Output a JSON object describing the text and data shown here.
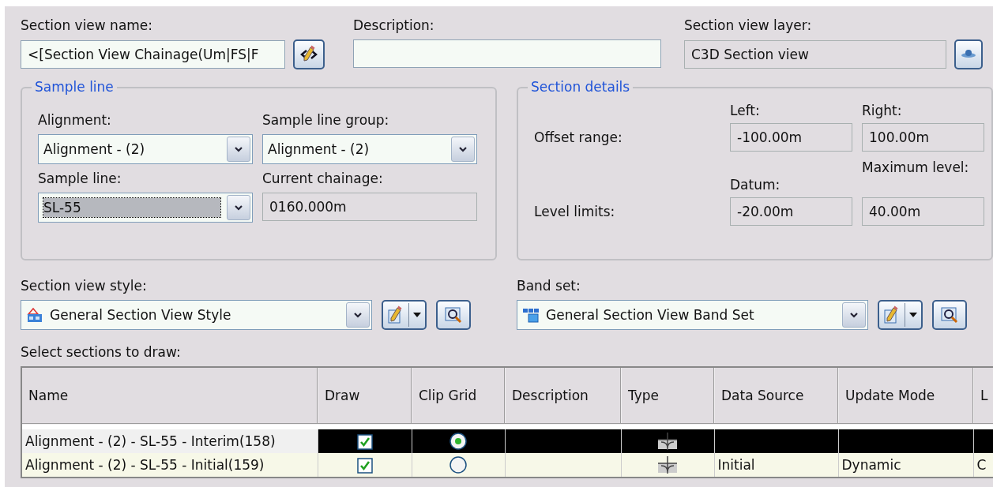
{
  "name_field": {
    "label": "Section view name:",
    "value": "<[Section View Chainage(Um|FS|F",
    "disabled": false
  },
  "description_field": {
    "label": "Description:",
    "disabled": false
  },
  "layer_field": {
    "label": "Section view layer:",
    "value": "C3D Section view",
    "disabled": true
  },
  "sample_line": {
    "title": "Sample line",
    "alignment": {
      "label": "Alignment:",
      "value": "Alignment - (2)"
    },
    "group": {
      "label": "Sample line group:",
      "value": "Alignment - (2)"
    },
    "line": {
      "label": "Sample line:",
      "value": "SL-55",
      "focused": true
    },
    "chainage": {
      "label": "Current chainage:",
      "value": "0160.000m",
      "disabled": true
    }
  },
  "section_details": {
    "title": "Section details",
    "offset_label": "Offset range:",
    "level_label": "Level limits:",
    "left": {
      "label": "Left:",
      "value": "-100.00m",
      "disabled": true
    },
    "right": {
      "label": "Right:",
      "value": "100.00m",
      "disabled": true
    },
    "datum": {
      "label": "Datum:",
      "value": "-20.00m",
      "disabled": true
    },
    "maximum": {
      "label": "Maximum level:",
      "value": "40.00m",
      "disabled": true
    }
  },
  "style": {
    "label": "Section view style:",
    "value": "General Section View Style"
  },
  "band_set": {
    "label": "Band set:",
    "value": "General Section View Band Set"
  },
  "sections": {
    "label": "Select sections to draw:",
    "columns": [
      "Name",
      "Draw",
      "Clip Grid",
      "Description",
      "Type",
      "Data Source",
      "Update Mode",
      "L"
    ],
    "rows": [
      {
        "name": "Alignment - (2) - SL-55 - Interim(158)",
        "draw": true,
        "clip_grid": true,
        "selected": true
      },
      {
        "name": "Alignment - (2) - SL-55 - Initial(159)",
        "draw": true,
        "clip_grid": false,
        "data_source": "Initial",
        "update_mode": "Dynamic",
        "column_8": "C",
        "selected": false
      }
    ]
  }
}
